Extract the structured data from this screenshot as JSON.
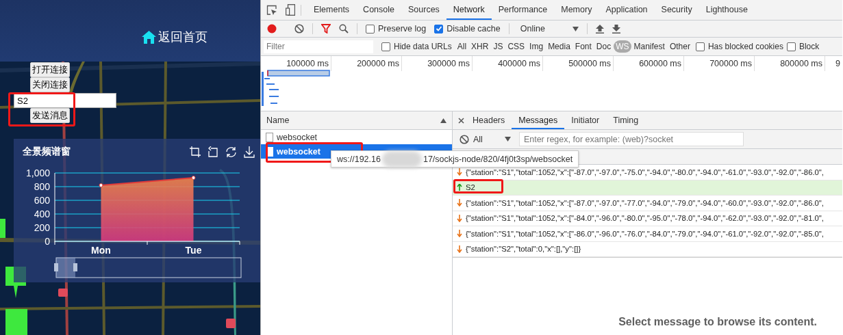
{
  "map_app": {
    "header": {
      "home_link": "返回首页"
    },
    "controls": {
      "open_button": "打开连接",
      "close_button": "关闭连接",
      "message_input": "S2",
      "send_button": "发送消息"
    },
    "chart_panel": {
      "title": "全景频谱窗",
      "chart_data": {
        "type": "area",
        "grid": true,
        "categories": [
          "Mon",
          "Tue"
        ],
        "values": [
          820,
          930
        ],
        "ylim": [
          0,
          1000
        ],
        "yticks": [
          0,
          200,
          400,
          600,
          800,
          {
            "value": 1000,
            "label": "1,000"
          }
        ]
      }
    }
  },
  "devtools": {
    "main_tabs": [
      {
        "label": "Elements",
        "selected": false
      },
      {
        "label": "Console",
        "selected": false
      },
      {
        "label": "Sources",
        "selected": false
      },
      {
        "label": "Network",
        "selected": true
      },
      {
        "label": "Performance",
        "selected": false
      },
      {
        "label": "Memory",
        "selected": false
      },
      {
        "label": "Application",
        "selected": false
      },
      {
        "label": "Security",
        "selected": false
      },
      {
        "label": "Lighthouse",
        "selected": false
      }
    ],
    "toolbar": {
      "preserve_log": {
        "label": "Preserve log",
        "checked": false
      },
      "disable_cache": {
        "label": "Disable cache",
        "checked": true
      },
      "throttling": "Online"
    },
    "filter_bar": {
      "placeholder": "Filter",
      "hide_data_urls": {
        "label": "Hide data URLs",
        "checked": false
      },
      "types": [
        {
          "label": "All",
          "selected": false
        },
        {
          "label": "XHR",
          "selected": false
        },
        {
          "label": "JS",
          "selected": false
        },
        {
          "label": "CSS",
          "selected": false
        },
        {
          "label": "Img",
          "selected": false
        },
        {
          "label": "Media",
          "selected": false
        },
        {
          "label": "Font",
          "selected": false
        },
        {
          "label": "Doc",
          "selected": false
        },
        {
          "label": "WS",
          "selected": true
        },
        {
          "label": "Manifest",
          "selected": false
        },
        {
          "label": "Other",
          "selected": false
        }
      ],
      "has_blocked_cookies": {
        "label": "Has blocked cookies",
        "checked": false
      },
      "blocked_requests": {
        "label": "Block",
        "checked": false
      }
    },
    "timeline": {
      "ticks": [
        "100000 ms",
        "200000 ms",
        "300000 ms",
        "400000 ms",
        "500000 ms",
        "600000 ms",
        "700000 ms",
        "800000 ms",
        "9"
      ]
    },
    "requests": {
      "column": "Name",
      "items": [
        {
          "name": "websocket",
          "selected": false
        },
        {
          "name": "websocket",
          "selected": true
        }
      ],
      "tooltip": {
        "before_blur": "ws://192.16",
        "after_blur": "17/sockjs-node/820/4fj0t3sp/websocket"
      }
    },
    "detail": {
      "tabs": [
        {
          "label": "Headers",
          "selected": false
        },
        {
          "label": "Messages",
          "selected": true
        },
        {
          "label": "Initiator",
          "selected": false
        },
        {
          "label": "Timing",
          "selected": false
        }
      ],
      "message_filter": {
        "type": "All",
        "placeholder": "Enter regex, for example: (web)?socket"
      },
      "messages": [
        {
          "kind": "received",
          "text": "{\"station\":\"S1\",\"total\":1052,\"x\":[\"-87.0\",\"-97.0\",\"-75.0\",\"-94.0\",\"-80.0\",\"-94.0\",\"-61.0\",\"-93.0\",\"-92.0\",\"-86.0\","
        },
        {
          "kind": "sent",
          "text": "S2"
        },
        {
          "kind": "received",
          "text": "{\"station\":\"S1\",\"total\":1052,\"x\":[\"-87.0\",\"-97.0\",\"-77.0\",\"-94.0\",\"-79.0\",\"-94.0\",\"-60.0\",\"-93.0\",\"-92.0\",\"-86.0\","
        },
        {
          "kind": "received",
          "text": "{\"station\":\"S1\",\"total\":1052,\"x\":[\"-84.0\",\"-96.0\",\"-80.0\",\"-95.0\",\"-78.0\",\"-94.0\",\"-62.0\",\"-93.0\",\"-92.0\",\"-81.0\","
        },
        {
          "kind": "received",
          "text": "{\"station\":\"S1\",\"total\":1052,\"x\":[\"-86.0\",\"-96.0\",\"-76.0\",\"-84.0\",\"-79.0\",\"-94.0\",\"-61.0\",\"-92.0\",\"-92.0\",\"-85.0\","
        },
        {
          "kind": "received",
          "text": "{\"station\":\"S2\",\"total\":0,\"x\":[],\"y\":[]}"
        }
      ],
      "empty_hint": "Select message to browse its content."
    }
  }
}
